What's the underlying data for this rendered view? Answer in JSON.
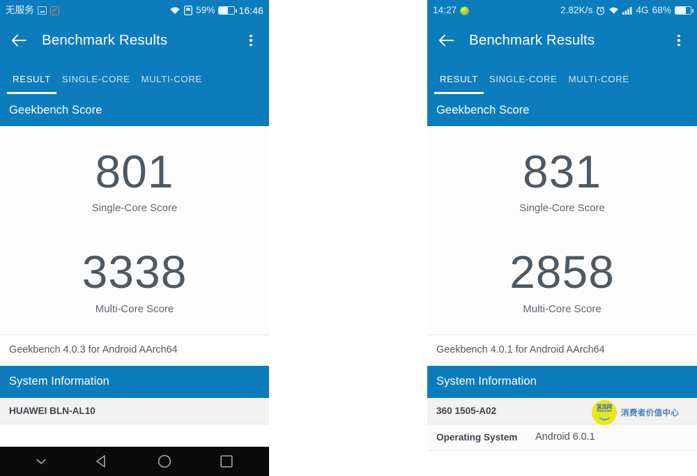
{
  "phones": [
    {
      "id": "left",
      "status_bar": {
        "carrier": "无服务",
        "icons": [
          "picture-icon",
          "mute-icon"
        ],
        "wifi": "wifi-icon",
        "sim": "sim-card-icon",
        "battery_percent": "59%",
        "battery_level": 59,
        "time": "16:46"
      },
      "appbar": {
        "back": "back-arrow-icon",
        "title": "Benchmark Results",
        "overflow": "overflow-menu-icon"
      },
      "tabs": [
        {
          "label": "RESULT",
          "active": true
        },
        {
          "label": "SINGLE-CORE",
          "active": false
        },
        {
          "label": "MULTI-CORE",
          "active": false
        }
      ],
      "score_section": {
        "header": "Geekbench Score",
        "scores": [
          {
            "value": "801",
            "label": "Single-Core Score"
          },
          {
            "value": "3338",
            "label": "Multi-Core Score"
          }
        ]
      },
      "version": "Geekbench 4.0.3 for Android AArch64",
      "system_section": {
        "header": "System Information",
        "rows": [
          {
            "key": "HUAWEI BLN-AL10",
            "value": ""
          }
        ]
      },
      "navbar": {
        "items": [
          "chevron-down-icon",
          "back-triangle-icon",
          "home-circle-icon",
          "recents-square-icon"
        ]
      }
    },
    {
      "id": "right",
      "status_bar": {
        "time": "14:27",
        "badge": "green-dot-icon",
        "network_speed": "2.82K/s",
        "alarm": "alarm-icon",
        "wifi": "wifi-icon",
        "signal": "signal-bars-icon",
        "network_type": "4G",
        "battery_percent": "68%",
        "battery_level": 68
      },
      "appbar": {
        "back": "back-arrow-icon",
        "title": "Benchmark Results",
        "overflow": "overflow-menu-icon"
      },
      "tabs": [
        {
          "label": "RESULT",
          "active": true
        },
        {
          "label": "SINGLE-CORE",
          "active": false
        },
        {
          "label": "MULTI-CORE",
          "active": false
        }
      ],
      "score_section": {
        "header": "Geekbench Score",
        "scores": [
          {
            "value": "831",
            "label": "Single-Core Score"
          },
          {
            "value": "2858",
            "label": "Multi-Core Score"
          }
        ]
      },
      "version": "Geekbench 4.0.1 for Android AArch64",
      "system_section": {
        "header": "System Information",
        "rows": [
          {
            "key": "360 1505-A02",
            "value": ""
          },
          {
            "key": "Operating System",
            "value": "Android 6.0.1"
          }
        ]
      },
      "watermark": {
        "logo_cn": "富连网",
        "logo_en": "finet.com",
        "tagline": "消费者价值中心"
      }
    }
  ],
  "colors": {
    "primary_blue": "#0c7cbc",
    "score_text": "#4e5861",
    "row_bg": "#f2f2f2",
    "navbar_bg": "#0a0a0a",
    "watermark_yellow": "#e8e61e"
  }
}
